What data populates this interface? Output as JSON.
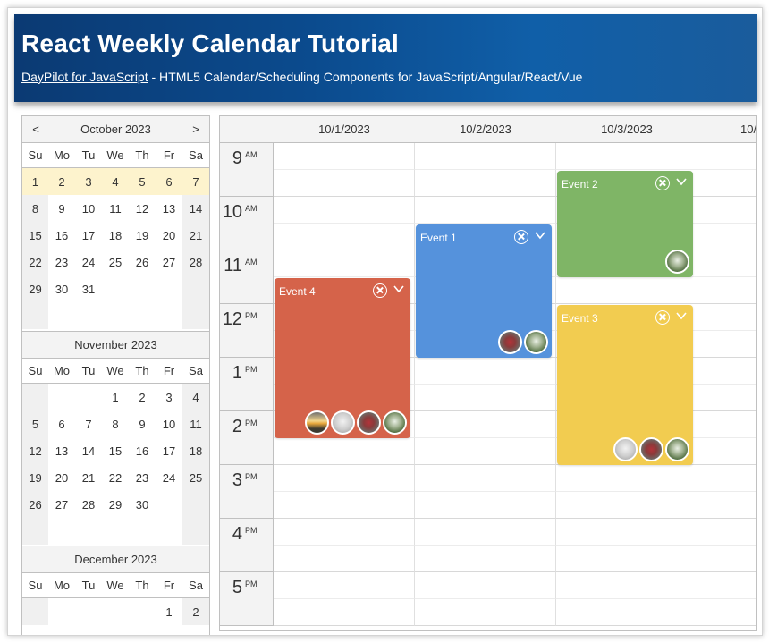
{
  "header": {
    "title": "React Weekly Calendar Tutorial",
    "link_text": "DayPilot for JavaScript",
    "subtitle": " - HTML5 Calendar/Scheduling Components for JavaScript/Angular/React/Vue"
  },
  "navigator": {
    "prev": "<",
    "next": ">",
    "days_of_week": [
      "Su",
      "Mo",
      "Tu",
      "We",
      "Th",
      "Fr",
      "Sa"
    ],
    "months": [
      {
        "title": "October 2023",
        "weeks": [
          [
            "1",
            "2",
            "3",
            "4",
            "5",
            "6",
            "7"
          ],
          [
            "8",
            "9",
            "10",
            "11",
            "12",
            "13",
            "14"
          ],
          [
            "15",
            "16",
            "17",
            "18",
            "19",
            "20",
            "21"
          ],
          [
            "22",
            "23",
            "24",
            "25",
            "26",
            "27",
            "28"
          ],
          [
            "29",
            "30",
            "31",
            "",
            "",
            "",
            ""
          ],
          [
            "",
            "",
            "",
            "",
            "",
            "",
            ""
          ]
        ]
      },
      {
        "title": "November 2023",
        "weeks": [
          [
            "",
            "",
            "",
            "1",
            "2",
            "3",
            "4"
          ],
          [
            "5",
            "6",
            "7",
            "8",
            "9",
            "10",
            "11"
          ],
          [
            "12",
            "13",
            "14",
            "15",
            "16",
            "17",
            "18"
          ],
          [
            "19",
            "20",
            "21",
            "22",
            "23",
            "24",
            "25"
          ],
          [
            "26",
            "27",
            "28",
            "29",
            "30",
            "",
            ""
          ],
          [
            "",
            "",
            "",
            "",
            "",
            "",
            ""
          ]
        ]
      },
      {
        "title": "December 2023",
        "weeks": [
          [
            "",
            "",
            "",
            "",
            "",
            "1",
            "2"
          ]
        ]
      }
    ]
  },
  "calendar": {
    "columns": [
      "10/1/2023",
      "10/2/2023",
      "10/3/2023",
      "10/"
    ],
    "hours": [
      {
        "hour": "9",
        "ampm": "AM"
      },
      {
        "hour": "10",
        "ampm": "AM"
      },
      {
        "hour": "11",
        "ampm": "AM"
      },
      {
        "hour": "12",
        "ampm": "PM"
      },
      {
        "hour": "1",
        "ampm": "PM"
      },
      {
        "hour": "2",
        "ampm": "PM"
      },
      {
        "hour": "3",
        "ampm": "PM"
      },
      {
        "hour": "4",
        "ampm": "PM"
      },
      {
        "hour": "5",
        "ampm": "PM"
      }
    ],
    "events": [
      {
        "text": "Event 4",
        "color": "#d5634a",
        "avatars": [
          "sunset",
          "fog",
          "door",
          "tree"
        ]
      },
      {
        "text": "Event 1",
        "color": "#5592dc",
        "avatars": [
          "door",
          "tree"
        ]
      },
      {
        "text": "Event 2",
        "color": "#7fb566",
        "avatars": [
          "tree"
        ]
      },
      {
        "text": "Event 3",
        "color": "#f2cc50",
        "avatars": [
          "fog",
          "door",
          "tree"
        ]
      }
    ]
  },
  "icons": {
    "delete": "circle-x-icon",
    "menu": "chevron-down-icon"
  }
}
